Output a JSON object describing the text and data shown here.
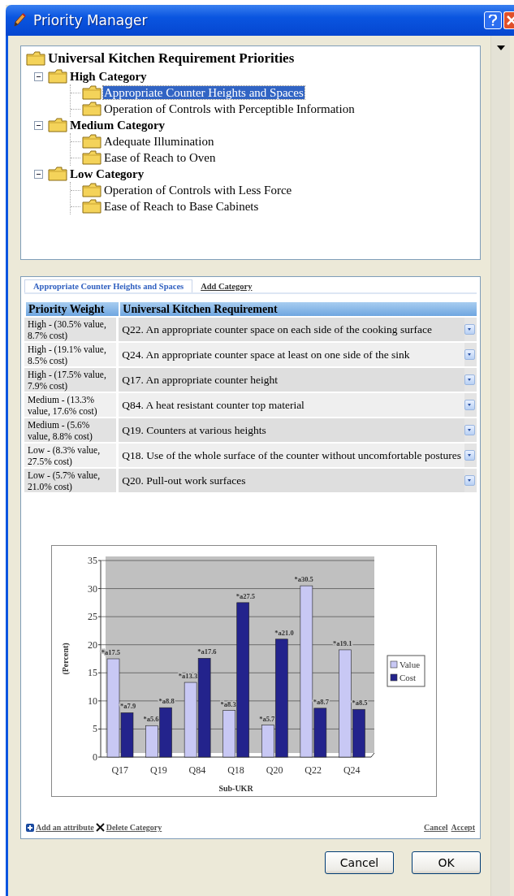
{
  "window": {
    "title": "Priority Manager"
  },
  "tree": {
    "label": "Universal Kitchen Requirement Priorities",
    "selected": false,
    "children": [
      {
        "label": "High Category",
        "expanded": true,
        "selected": false,
        "children": [
          {
            "label": "Appropriate Counter Heights and Spaces",
            "selected": true
          },
          {
            "label": "Operation of Controls with Perceptible Information",
            "selected": false
          }
        ]
      },
      {
        "label": "Medium Category",
        "expanded": true,
        "selected": false,
        "children": [
          {
            "label": "Adequate Illumination",
            "selected": false
          },
          {
            "label": "Ease of Reach to Oven",
            "selected": false
          }
        ]
      },
      {
        "label": "Low Category",
        "expanded": true,
        "selected": false,
        "children": [
          {
            "label": "Operation of Controls with Less Force",
            "selected": false
          },
          {
            "label": "Ease of Reach to Base Cabinets",
            "selected": false
          }
        ]
      }
    ]
  },
  "tabs": [
    {
      "label": "Appropriate Counter Heights and Spaces",
      "selected": true
    },
    {
      "label": "Add Category",
      "selected": false
    }
  ],
  "table": {
    "columns": [
      "Priority Weight",
      "Universal Kitchen Requirement"
    ],
    "rows": [
      {
        "priority_weight": "High - (30.5% value, 8.7% cost)",
        "requirement": "Q22. An appropriate counter space on each side of the cooking surface"
      },
      {
        "priority_weight": "High - (19.1% value, 8.5% cost)",
        "requirement": "Q24. An appropriate counter space at least on one side of the sink"
      },
      {
        "priority_weight": "High - (17.5% value, 7.9% cost)",
        "requirement": "Q17. An appropriate counter height"
      },
      {
        "priority_weight": "Medium - (13.3% value, 17.6% cost)",
        "requirement": "Q84. A heat resistant counter top material"
      },
      {
        "priority_weight": "Medium - (5.6% value, 8.8% cost)",
        "requirement": "Q19. Counters at various heights"
      },
      {
        "priority_weight": "Low - (8.3% value, 27.5% cost)",
        "requirement": "Q18. Use of the whole surface of the counter without uncomfortable postures"
      },
      {
        "priority_weight": "Low - (5.7% value, 21.0% cost)",
        "requirement": "Q20. Pull-out work surfaces"
      }
    ]
  },
  "chart_data": {
    "type": "bar",
    "xlabel": "Sub-UKR",
    "ylabel": "(Percent)",
    "categories": [
      "Q17",
      "Q19",
      "Q84",
      "Q18",
      "Q20",
      "Q22",
      "Q24"
    ],
    "series": [
      {
        "name": "Value",
        "color": "#c8c8f4",
        "values": [
          17.5,
          5.6,
          13.3,
          8.3,
          5.7,
          30.5,
          19.1
        ],
        "value_labels": [
          "*a17.5",
          "*a5.6",
          "*a13.3",
          "*a8.3",
          "*a5.7",
          "*a30.5",
          "*a19.1"
        ]
      },
      {
        "name": "Cost",
        "color": "#23238c",
        "values": [
          7.9,
          8.8,
          17.6,
          27.5,
          21.0,
          8.7,
          8.5
        ],
        "value_labels": [
          "*a7.9",
          "*a8.8",
          "*a17.6",
          "*a27.5",
          "*a21.0",
          "*a8.7",
          "*a8.5"
        ]
      }
    ],
    "ylim": [
      0,
      35
    ],
    "grid": true,
    "legend": "right",
    "yticks": [
      0,
      5,
      10,
      15,
      20,
      25,
      30,
      35
    ]
  },
  "footer_links_left": [
    "Add an attribute",
    "Delete Category"
  ],
  "footer_links_right": [
    "Cancel",
    "Accept"
  ],
  "buttons": [
    "Cancel",
    "OK"
  ]
}
